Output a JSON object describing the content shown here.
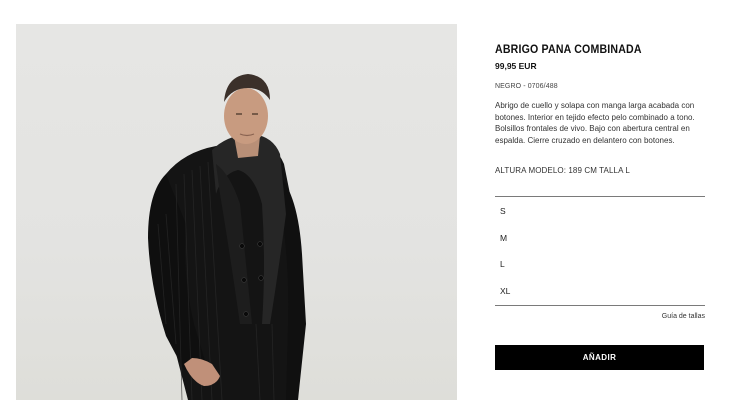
{
  "product": {
    "title": "ABRIGO PANA COMBINADA",
    "price": "99,95 EUR",
    "color_ref": "NEGRO - 0706/488",
    "description": "Abrigo de cuello y solapa con manga larga acabada con botones. Interior en tejido efecto pelo combinado a tono. Bolsillos frontales de vivo. Bajo con abertura central en espalda. Cierre cruzado en delantero con botones.",
    "model_info": "ALTURA MODELO: 189 CM TALLA L"
  },
  "sizes": [
    "S",
    "M",
    "L",
    "XL"
  ],
  "size_guide": "Guía de tallas",
  "add_button": "AÑADIR",
  "colors": {
    "button_bg": "#000000",
    "button_text": "#ffffff",
    "image_bg": "#e5e5e3"
  }
}
